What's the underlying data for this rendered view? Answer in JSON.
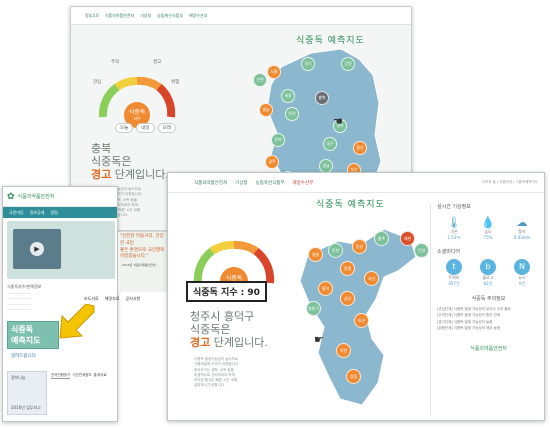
{
  "back_page": {
    "header_logos": [
      "정부3.0",
      "식품의약품안전처",
      "기상청",
      "농림축산식품부",
      "해양수산부"
    ],
    "title": "식중독 예측지도",
    "gauge_levels": [
      "관심",
      "주의",
      "경고",
      "위험"
    ],
    "gauge_center": {
      "label": "식중독",
      "sub": "지수"
    },
    "day_buttons": [
      "오늘",
      "내일",
      "모레"
    ],
    "region": "충북",
    "line2": "식중독은",
    "status_word": "경고",
    "status_suffix": " 단계입니다.",
    "note": [
      "식중독 발생가능성이 높으므로",
      "식품취급에 주의가 요망됩니다.",
      "조리도구는 세척, 소독 등을",
      "위생적으로 관리하여야 하며,",
      "조리한 음식은 빠른 시간 내에",
      "섭취하시기 바랍니다."
    ],
    "map_regions": [
      {
        "name": "강원",
        "color": "#7cc19a"
      },
      {
        "name": "경기",
        "color": "#7cc19a"
      },
      {
        "name": "서울",
        "color": "#f08a30"
      },
      {
        "name": "인천",
        "color": "#7cc19a"
      },
      {
        "name": "충북",
        "color": "#6b6f75"
      },
      {
        "name": "세종",
        "color": "#7cc19a"
      },
      {
        "name": "대전",
        "color": "#7cc19a"
      },
      {
        "name": "충남",
        "color": "#f08a30"
      },
      {
        "name": "경북",
        "color": "#7cc19a"
      },
      {
        "name": "대구",
        "color": "#7cc19a"
      },
      {
        "name": "울산",
        "color": "#f08a30"
      },
      {
        "name": "전북",
        "color": "#7cc19a"
      },
      {
        "name": "경남",
        "color": "#7cc19a"
      },
      {
        "name": "광주",
        "color": "#f08a30"
      },
      {
        "name": "부산",
        "color": "#f08a30"
      },
      {
        "name": "전남",
        "color": "#7cc19a"
      },
      {
        "name": "제주",
        "color": "#7cc19a"
      }
    ]
  },
  "left_page": {
    "site_name": "식품의약품안전처",
    "nav": [
      "국민마당",
      "정보공개",
      "알림"
    ],
    "hero_text": [
      "\"안전한 먹을거리, 건강한 국민",
      "좋은 환경으로 국민행복",
      "이끌겠습니다.\""
    ],
    "hero_caption": "- 2016년 식품의약품안전처 -",
    "news_tabs": [
      "보도자료",
      "해명자료",
      "공지사항"
    ],
    "sidebar_label": "식중독지수/판례정보",
    "badge_title": "식중독",
    "badge_sub": "예측지도",
    "notice_label": "알려드립니다",
    "widget_title": "정보나눔",
    "widget_sub": "2016년 업무보고",
    "link_tabs": [
      "전자민원창구",
      "기관연계정보",
      "통계자료"
    ]
  },
  "front_page": {
    "header_logos": [
      "식품의약품안전처",
      "기상청",
      "농림축산식품부",
      "해양수산부"
    ],
    "top_links": "식약처 홈  |  이용안내  |  식중독예측지도",
    "title": "식중독 예측지도",
    "index_label": "식중독 지수 : 90",
    "gauge_center": {
      "label": "식중독",
      "sub": "지수"
    },
    "region": "청주시 흥덕구",
    "line2": "식중독은",
    "status_word": "경고",
    "status_suffix": " 단계입니다.",
    "note": [
      "식중독 발생가능성이 높으므로",
      "식품취급에 주의가 요망됩니다.",
      "조리도구는 세척, 소독 등을",
      "위생적으로 관리하여야 하며,",
      "조리한 음식은 빠른 시간 내에",
      "섭취하시기 바랍니다."
    ],
    "weather_title": "실시간 기상정보",
    "weather": [
      {
        "name": "기온",
        "value": "1.53℃"
      },
      {
        "name": "습도",
        "value": "75%"
      },
      {
        "name": "풍속",
        "value": "0.03m/s"
      }
    ],
    "media_title": "소셜미디어",
    "media": [
      {
        "name": "트위터",
        "value": "457건"
      },
      {
        "name": "블로그",
        "value": "62건"
      },
      {
        "name": "뉴스",
        "value": "0건"
      }
    ],
    "info_title": "식중독 주의정보",
    "info_lines": [
      "[관심단계] 식중독 발생 가능성이 낮으나 주의 필요",
      "[주의단계] 식중독 발생 가능성이 중간 단계",
      "[경고단계] 식중독 발생 가능성이 높음",
      "[위험단계] 식중독 발생 가능성이 매우 높음"
    ],
    "bottom_logo": "식품의약품안전처",
    "map_regions": [
      {
        "name": "청원",
        "color": "#f08a30"
      },
      {
        "name": "진천",
        "color": "#7cc19a"
      },
      {
        "name": "음성",
        "color": "#f08a30"
      },
      {
        "name": "충주",
        "color": "#7cc19a"
      },
      {
        "name": "제천",
        "color": "#d8502a"
      },
      {
        "name": "단양",
        "color": "#7cc19a"
      },
      {
        "name": "증평",
        "color": "#f08a30"
      },
      {
        "name": "괴산",
        "color": "#f08a30"
      },
      {
        "name": "흥덕",
        "color": "#f08a30"
      },
      {
        "name": "상당",
        "color": "#f08a30"
      },
      {
        "name": "청원구",
        "color": "#7cc19a"
      },
      {
        "name": "보은",
        "color": "#f08a30"
      },
      {
        "name": "옥천",
        "color": "#f08a30"
      },
      {
        "name": "영동",
        "color": "#f08a30"
      }
    ]
  },
  "colors": {
    "brand_green": "#2f8e5c",
    "warning_orange": "#e06b1f",
    "map_blue": "#8cb8cf",
    "safe_green": "#7cc19a"
  }
}
